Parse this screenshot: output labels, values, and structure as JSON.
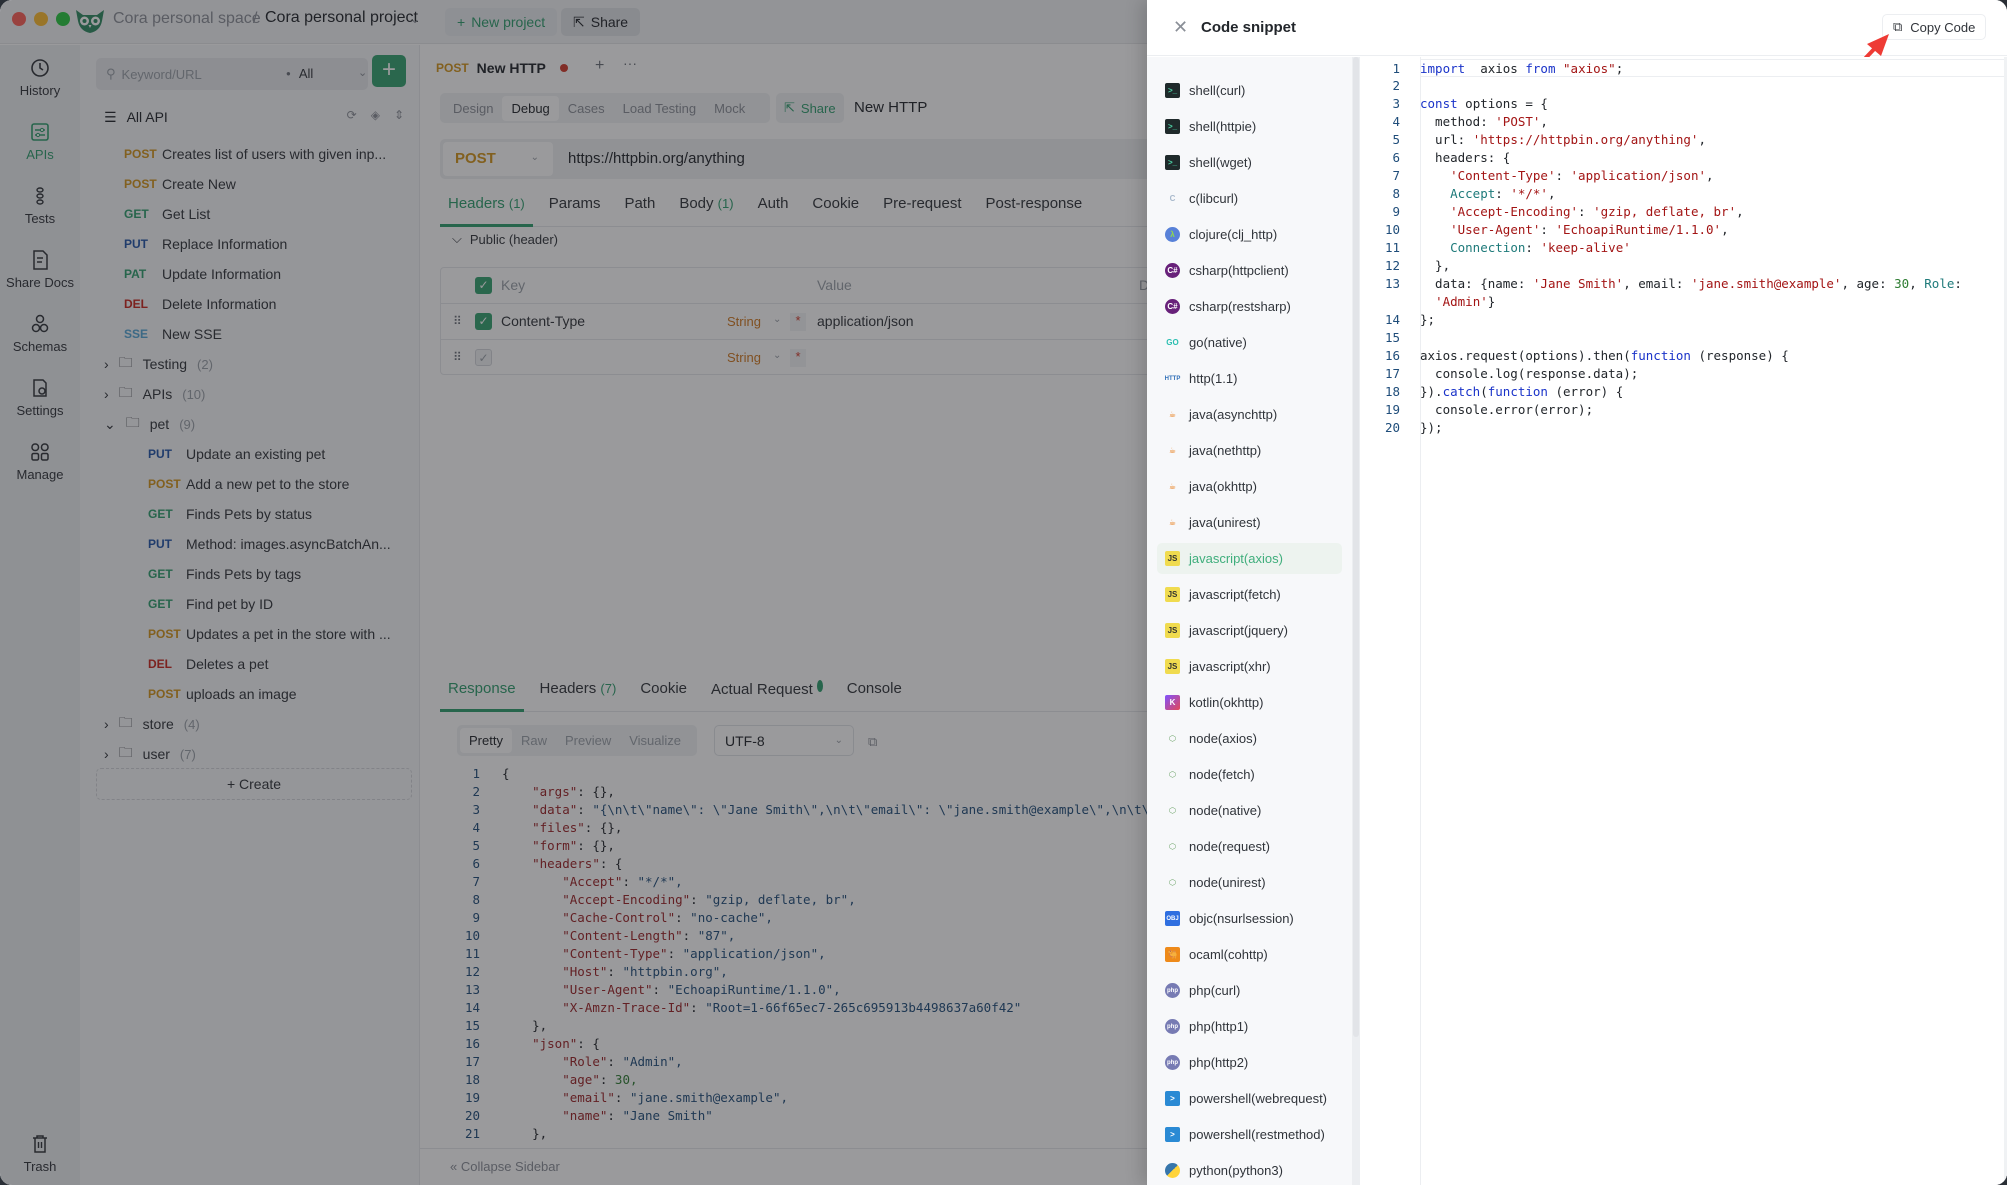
{
  "window": {
    "workspace": "Cora personal space",
    "separator": "/",
    "project": "Cora personal project",
    "new_project_label": "New project",
    "share_label": "Share"
  },
  "rail": {
    "items": [
      {
        "label": "History",
        "icon": "history-icon",
        "active": false
      },
      {
        "label": "APIs",
        "icon": "apis-icon",
        "active": true
      },
      {
        "label": "Tests",
        "icon": "tests-icon",
        "active": false
      },
      {
        "label": "Share Docs",
        "icon": "share-docs-icon",
        "active": false
      },
      {
        "label": "Schemas",
        "icon": "schemas-icon",
        "active": false
      },
      {
        "label": "Settings",
        "icon": "settings-icon",
        "active": false
      },
      {
        "label": "Manage",
        "icon": "manage-icon",
        "active": false
      }
    ],
    "trash_label": "Trash"
  },
  "sidebar": {
    "search_placeholder": "Keyword/URL",
    "filter_value": "All",
    "all_api_label": "All API",
    "root_items": [
      {
        "method": "POST",
        "name": "Creates list of users with given inp..."
      },
      {
        "method": "POST",
        "name": "Create New"
      },
      {
        "method": "GET",
        "name": "Get List"
      },
      {
        "method": "PUT",
        "name": "Replace Information"
      },
      {
        "method": "PAT",
        "name": "Update Information"
      },
      {
        "method": "DEL",
        "name": "Delete Information"
      },
      {
        "method": "SSE",
        "name": "New SSE"
      }
    ],
    "folders_before": [
      {
        "name": "Testing",
        "count": "(2)",
        "expanded": false
      },
      {
        "name": "APIs",
        "count": "(10)",
        "expanded": false
      },
      {
        "name": "pet",
        "count": "(9)",
        "expanded": true
      }
    ],
    "pet_items": [
      {
        "method": "PUT",
        "name": "Update an existing pet"
      },
      {
        "method": "POST",
        "name": "Add a new pet to the store"
      },
      {
        "method": "GET",
        "name": "Finds Pets by status"
      },
      {
        "method": "PUT",
        "name": "Method: images.asyncBatchAn..."
      },
      {
        "method": "GET",
        "name": "Finds Pets by tags"
      },
      {
        "method": "GET",
        "name": "Find pet by ID"
      },
      {
        "method": "POST",
        "name": "Updates a pet in the store with ..."
      },
      {
        "method": "DEL",
        "name": "Deletes a pet"
      },
      {
        "method": "POST",
        "name": "uploads an image"
      }
    ],
    "folders_after": [
      {
        "name": "store",
        "count": "(4)",
        "expanded": false
      },
      {
        "name": "user",
        "count": "(7)",
        "expanded": false
      }
    ],
    "create_label": "Create"
  },
  "main": {
    "tab": {
      "method": "POST",
      "title": "New HTTP",
      "unsaved": true
    },
    "modes": [
      "Design",
      "Debug",
      "Cases",
      "Load Testing",
      "Mock"
    ],
    "active_mode": "Debug",
    "share_label": "Share",
    "request_name": "New HTTP",
    "method": "POST",
    "url": "https://httpbin.org/anything",
    "request_tabs": [
      {
        "label": "Headers",
        "count": "(1)",
        "active": true
      },
      {
        "label": "Params",
        "count": "",
        "active": false
      },
      {
        "label": "Path",
        "count": "",
        "active": false
      },
      {
        "label": "Body",
        "count": "(1)",
        "active": false
      },
      {
        "label": "Auth",
        "count": "",
        "active": false
      },
      {
        "label": "Cookie",
        "count": "",
        "active": false
      },
      {
        "label": "Pre-request",
        "count": "",
        "active": false
      },
      {
        "label": "Post-response",
        "count": "",
        "active": false
      }
    ],
    "public_header_label": "Public  (header)",
    "headers_table": {
      "columns": [
        "Key",
        "Value",
        "Desc"
      ],
      "rows": [
        {
          "checked": true,
          "key": "Content-Type",
          "type": "String",
          "value": "application/json"
        },
        {
          "checked": false,
          "key": "",
          "type": "String",
          "value": ""
        }
      ]
    },
    "response_tabs": [
      {
        "label": "Response",
        "count": "",
        "active": true
      },
      {
        "label": "Headers",
        "count": "(7)",
        "active": false
      },
      {
        "label": "Cookie",
        "count": "",
        "active": false
      },
      {
        "label": "Actual Request",
        "count": "",
        "active": false,
        "dot": true
      },
      {
        "label": "Console",
        "count": "",
        "active": false
      }
    ],
    "view_modes": [
      "Pretty",
      "Raw",
      "Preview",
      "Visualize"
    ],
    "active_view": "Pretty",
    "encoding": "UTF-8",
    "response_lines": [
      "{",
      "    \"args\": {},",
      "    \"data\": \"{\\n\\t\\\"name\\\": \\\"Jane Smith\\\",\\n\\t\\\"email\\\": \\\"jane.smith@example\\\",\\n\\t\\\"ag",
      "    \"files\": {},",
      "    \"form\": {},",
      "    \"headers\": {",
      "        \"Accept\": \"*/*\",",
      "        \"Accept-Encoding\": \"gzip, deflate, br\",",
      "        \"Cache-Control\": \"no-cache\",",
      "        \"Content-Length\": \"87\",",
      "        \"Content-Type\": \"application/json\",",
      "        \"Host\": \"httpbin.org\",",
      "        \"User-Agent\": \"EchoapiRuntime/1.1.0\",",
      "        \"X-Amzn-Trace-Id\": \"Root=1-66f65ec7-265c695913b4498637a60f42\"",
      "    },",
      "    \"json\": {",
      "        \"Role\": \"Admin\",",
      "        \"age\": 30,",
      "        \"email\": \"jane.smith@example\",",
      "        \"name\": \"Jane Smith\"",
      "    },"
    ],
    "collapse_label": "Collapse Sidebar"
  },
  "drawer": {
    "title": "Code snippet",
    "copy_label": "Copy Code",
    "languages": [
      {
        "label": "shell(curl)",
        "icon": "terminal-icon"
      },
      {
        "label": "shell(httpie)",
        "icon": "terminal-icon"
      },
      {
        "label": "shell(wget)",
        "icon": "terminal-icon"
      },
      {
        "label": "c(libcurl)",
        "icon": "c-lang-icon"
      },
      {
        "label": "clojure(clj_http)",
        "icon": "clojure-icon"
      },
      {
        "label": "csharp(httpclient)",
        "icon": "csharp-icon"
      },
      {
        "label": "csharp(restsharp)",
        "icon": "csharp-icon"
      },
      {
        "label": "go(native)",
        "icon": "go-icon"
      },
      {
        "label": "http(1.1)",
        "icon": "http-icon"
      },
      {
        "label": "java(asynchttp)",
        "icon": "java-icon"
      },
      {
        "label": "java(nethttp)",
        "icon": "java-icon"
      },
      {
        "label": "java(okhttp)",
        "icon": "java-icon"
      },
      {
        "label": "java(unirest)",
        "icon": "java-icon"
      },
      {
        "label": "javascript(axios)",
        "icon": "javascript-icon",
        "active": true
      },
      {
        "label": "javascript(fetch)",
        "icon": "javascript-icon"
      },
      {
        "label": "javascript(jquery)",
        "icon": "javascript-icon"
      },
      {
        "label": "javascript(xhr)",
        "icon": "javascript-icon"
      },
      {
        "label": "kotlin(okhttp)",
        "icon": "kotlin-icon"
      },
      {
        "label": "node(axios)",
        "icon": "nodejs-icon"
      },
      {
        "label": "node(fetch)",
        "icon": "nodejs-icon"
      },
      {
        "label": "node(native)",
        "icon": "nodejs-icon"
      },
      {
        "label": "node(request)",
        "icon": "nodejs-icon"
      },
      {
        "label": "node(unirest)",
        "icon": "nodejs-icon"
      },
      {
        "label": "objc(nsurlsession)",
        "icon": "objc-icon"
      },
      {
        "label": "ocaml(cohttp)",
        "icon": "ocaml-icon"
      },
      {
        "label": "php(curl)",
        "icon": "php-icon"
      },
      {
        "label": "php(http1)",
        "icon": "php-icon"
      },
      {
        "label": "php(http2)",
        "icon": "php-icon"
      },
      {
        "label": "powershell(webrequest)",
        "icon": "powershell-icon"
      },
      {
        "label": "powershell(restmethod)",
        "icon": "powershell-icon"
      },
      {
        "label": "python(python3)",
        "icon": "python-icon"
      }
    ],
    "code_lines": [
      {
        "n": "1",
        "tokens": [
          [
            "kw",
            "import"
          ],
          [
            "",
            "  axios "
          ],
          [
            "kw",
            "from"
          ],
          [
            "",
            " "
          ],
          [
            "str",
            "\"axios\""
          ],
          [
            "",
            ";"
          ]
        ]
      },
      {
        "n": "2",
        "tokens": []
      },
      {
        "n": "3",
        "tokens": [
          [
            "kw",
            "const"
          ],
          [
            "",
            " options = {"
          ]
        ]
      },
      {
        "n": "4",
        "tokens": [
          [
            "",
            "  method: "
          ],
          [
            "str",
            "'POST'"
          ],
          [
            "",
            ","
          ]
        ]
      },
      {
        "n": "5",
        "tokens": [
          [
            "",
            "  url: "
          ],
          [
            "str",
            "'https://httpbin.org/anything'"
          ],
          [
            "",
            ","
          ]
        ]
      },
      {
        "n": "6",
        "tokens": [
          [
            "",
            "  headers: {"
          ]
        ]
      },
      {
        "n": "7",
        "tokens": [
          [
            "",
            "    "
          ],
          [
            "str",
            "'Content-Type'"
          ],
          [
            "",
            ": "
          ],
          [
            "str",
            "'application/json'"
          ],
          [
            "",
            ","
          ]
        ]
      },
      {
        "n": "8",
        "tokens": [
          [
            "",
            "    "
          ],
          [
            "prop",
            "Accept"
          ],
          [
            "",
            ": "
          ],
          [
            "str",
            "'*/*'"
          ],
          [
            "",
            ","
          ]
        ]
      },
      {
        "n": "9",
        "tokens": [
          [
            "",
            "    "
          ],
          [
            "str",
            "'Accept-Encoding'"
          ],
          [
            "",
            ": "
          ],
          [
            "str",
            "'gzip, deflate, br'"
          ],
          [
            "",
            ","
          ]
        ]
      },
      {
        "n": "10",
        "tokens": [
          [
            "",
            "    "
          ],
          [
            "str",
            "'User-Agent'"
          ],
          [
            "",
            ": "
          ],
          [
            "str",
            "'EchoapiRuntime/1.1.0'"
          ],
          [
            "",
            ","
          ]
        ]
      },
      {
        "n": "11",
        "tokens": [
          [
            "",
            "    "
          ],
          [
            "prop",
            "Connection"
          ],
          [
            "",
            ": "
          ],
          [
            "str",
            "'keep-alive'"
          ]
        ]
      },
      {
        "n": "12",
        "tokens": [
          [
            "",
            "  },"
          ]
        ]
      },
      {
        "n": "13",
        "tokens": [
          [
            "",
            "  data: {name: "
          ],
          [
            "str",
            "'Jane Smith'"
          ],
          [
            "",
            ", email: "
          ],
          [
            "str",
            "'jane.smith@example'"
          ],
          [
            "",
            ", age: "
          ],
          [
            "num",
            "30"
          ],
          [
            "",
            ", "
          ],
          [
            "prop",
            "Role"
          ],
          [
            "",
            ":"
          ]
        ]
      },
      {
        "n": "",
        "tokens": [
          [
            "",
            "  "
          ],
          [
            "str",
            "'Admin'"
          ],
          [
            "",
            "}"
          ]
        ]
      },
      {
        "n": "14",
        "tokens": [
          [
            "",
            "};"
          ]
        ]
      },
      {
        "n": "15",
        "tokens": []
      },
      {
        "n": "16",
        "tokens": [
          [
            "",
            "axios.request(options).then("
          ],
          [
            "kw",
            "function"
          ],
          [
            "",
            " (response) {"
          ]
        ]
      },
      {
        "n": "17",
        "tokens": [
          [
            "",
            "  console.log(response.data);"
          ]
        ]
      },
      {
        "n": "18",
        "tokens": [
          [
            "",
            "})."
          ],
          [
            "kw",
            "catch"
          ],
          [
            "",
            "("
          ],
          [
            "kw",
            "function"
          ],
          [
            "",
            " (error) {"
          ]
        ]
      },
      {
        "n": "19",
        "tokens": [
          [
            "",
            "  console.error(error);"
          ]
        ]
      },
      {
        "n": "20",
        "tokens": [
          [
            "",
            "});"
          ]
        ]
      }
    ]
  }
}
